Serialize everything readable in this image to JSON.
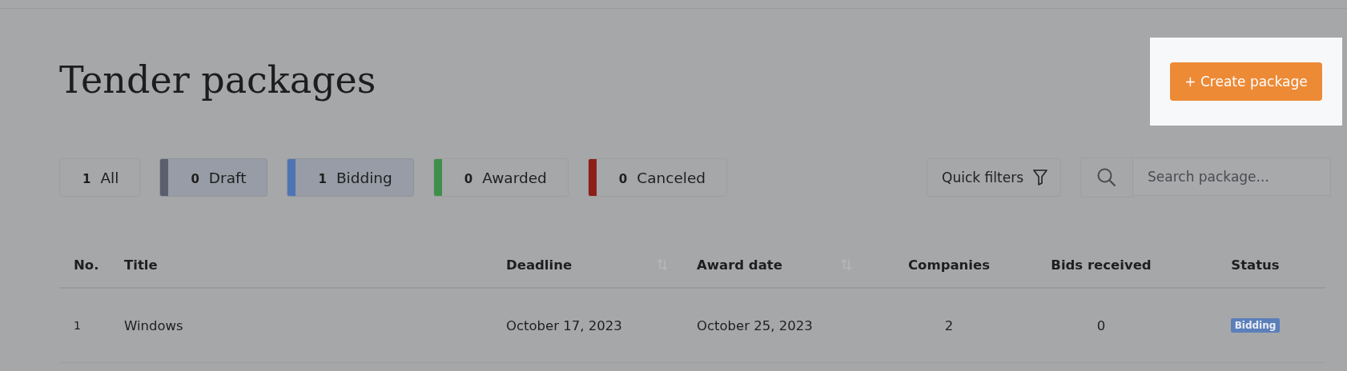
{
  "page": {
    "title": "Tender packages"
  },
  "create_button": {
    "label": "+ Create package",
    "highlighted": true
  },
  "chips": [
    {
      "count": "1",
      "label": "All",
      "selected": false
    },
    {
      "count": "0",
      "label": "Draft",
      "selected": true,
      "color": "#5a5e6e"
    },
    {
      "count": "1",
      "label": "Bidding",
      "selected": true,
      "color": "#4f74b3"
    },
    {
      "count": "0",
      "label": "Awarded",
      "selected": false,
      "color": "#3f8f4c"
    },
    {
      "count": "0",
      "label": "Canceled",
      "selected": false,
      "color": "#8c1f18"
    }
  ],
  "quick_filters": {
    "label": "Quick filters"
  },
  "search": {
    "placeholder": "Search package..."
  },
  "table": {
    "columns": [
      {
        "label": "No.",
        "sortable": false
      },
      {
        "label": "Title",
        "sortable": false
      },
      {
        "label": "Deadline",
        "sortable": true
      },
      {
        "label": "Award date",
        "sortable": true
      },
      {
        "label": "Companies",
        "sortable": false
      },
      {
        "label": "Bids received",
        "sortable": false
      },
      {
        "label": "Status",
        "sortable": false
      }
    ],
    "rows": [
      {
        "cells": [
          "1",
          "Windows",
          "October 17, 2023",
          "October 25, 2023",
          "2",
          "0"
        ],
        "status": {
          "label": "Bidding",
          "color": "#5b7fb9"
        }
      }
    ]
  }
}
